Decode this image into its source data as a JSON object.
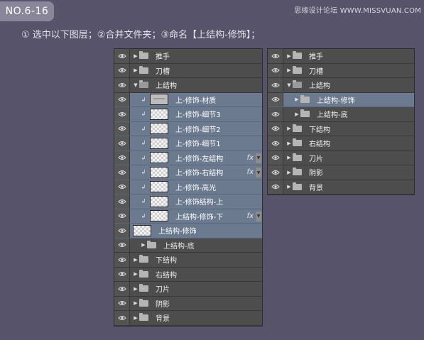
{
  "badge": "NO.6-16",
  "watermark": "思缘设计论坛 WWW.MISSVUAN.COM",
  "instruction": "① 选中以下图层；②合并文件夹；③命名【上结构-修饰】；",
  "left_panel": {
    "rows": [
      {
        "label": "推手",
        "kind": "group",
        "indent": 0,
        "selected": false
      },
      {
        "label": "刀槽",
        "kind": "group",
        "indent": 0,
        "selected": false
      },
      {
        "label": "上结构",
        "kind": "group-open",
        "indent": 0,
        "selected": false
      },
      {
        "label": "上-修饰-材质",
        "kind": "layer",
        "thumb": "grey",
        "clip": true,
        "indent": 1,
        "selected": true
      },
      {
        "label": "上-修饰-细节3",
        "kind": "layer",
        "clip": true,
        "indent": 1,
        "selected": true
      },
      {
        "label": "上-修饰-细节2",
        "kind": "layer",
        "clip": true,
        "indent": 1,
        "selected": true
      },
      {
        "label": "上-修饰-细节1",
        "kind": "layer",
        "clip": true,
        "indent": 1,
        "selected": true
      },
      {
        "label": "上-修饰-左结构",
        "kind": "layer",
        "clip": true,
        "fx": true,
        "indent": 1,
        "selected": true
      },
      {
        "label": "上-修饰-右结构",
        "kind": "layer",
        "clip": true,
        "fx": true,
        "indent": 1,
        "selected": true
      },
      {
        "label": "上-修饰-高光",
        "kind": "layer",
        "clip": true,
        "indent": 1,
        "selected": true
      },
      {
        "label": "上-修饰结构-上",
        "kind": "layer",
        "clip": true,
        "indent": 1,
        "selected": true
      },
      {
        "label": "上结构-修饰-下",
        "kind": "layer",
        "clip": true,
        "fx": true,
        "indent": 1,
        "selected": true
      },
      {
        "label": "上结构-修饰",
        "kind": "layer",
        "clip": false,
        "indent": 1,
        "selected": true
      },
      {
        "label": "上结构-底",
        "kind": "group",
        "indent": 1,
        "selected": false
      },
      {
        "label": "下结构",
        "kind": "group",
        "indent": 0,
        "selected": false
      },
      {
        "label": "右结构",
        "kind": "group",
        "indent": 0,
        "selected": false
      },
      {
        "label": "刀片",
        "kind": "group",
        "indent": 0,
        "selected": false
      },
      {
        "label": "阴影",
        "kind": "group",
        "indent": 0,
        "selected": false
      },
      {
        "label": "背景",
        "kind": "group",
        "indent": 0,
        "selected": false
      }
    ]
  },
  "right_panel": {
    "rows": [
      {
        "label": "推手",
        "kind": "group",
        "indent": 0,
        "selected": false
      },
      {
        "label": "刀槽",
        "kind": "group",
        "indent": 0,
        "selected": false
      },
      {
        "label": "上结构",
        "kind": "group-open",
        "indent": 0,
        "selected": false
      },
      {
        "label": "上结构-修饰",
        "kind": "group",
        "indent": 1,
        "selected": true
      },
      {
        "label": "上结构-底",
        "kind": "group",
        "indent": 1,
        "selected": false
      },
      {
        "label": "下结构",
        "kind": "group",
        "indent": 0,
        "selected": false
      },
      {
        "label": "右结构",
        "kind": "group",
        "indent": 0,
        "selected": false
      },
      {
        "label": "刀片",
        "kind": "group",
        "indent": 0,
        "selected": false
      },
      {
        "label": "阴影",
        "kind": "group",
        "indent": 0,
        "selected": false
      },
      {
        "label": "背景",
        "kind": "group",
        "indent": 0,
        "selected": false
      }
    ]
  },
  "fx_label": "fx",
  "icons": {
    "visibility": "eye-icon",
    "group": "folder-icon",
    "expand": "triangle-icon",
    "clip": "clipping-arrow-icon"
  }
}
